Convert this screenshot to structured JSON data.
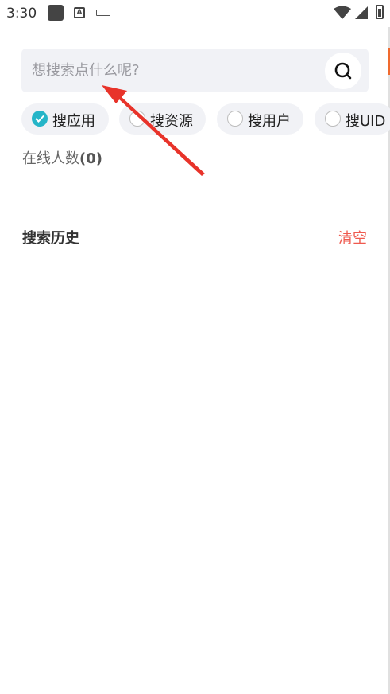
{
  "status_bar": {
    "time": "3:30",
    "icons": [
      "notification-square-icon",
      "font-a-icon",
      "keyboard-icon",
      "wifi-icon",
      "signal-icon",
      "battery-icon"
    ]
  },
  "search": {
    "placeholder": "想搜索点什么呢?",
    "value": "",
    "button_icon": "search-icon"
  },
  "filters": {
    "options": [
      {
        "label": "搜应用",
        "selected": true
      },
      {
        "label": "搜资源",
        "selected": false
      },
      {
        "label": "搜用户",
        "selected": false
      },
      {
        "label": "搜UID",
        "selected": false
      }
    ]
  },
  "online": {
    "label": "在线人数",
    "count_text": "(0)"
  },
  "history": {
    "title": "搜索历史",
    "clear_label": "清空"
  },
  "colors": {
    "accent": "#25b5c8",
    "clear": "#ef5a4f",
    "annotation_arrow": "#e8332a",
    "chip_bg": "#f1f2f6"
  }
}
